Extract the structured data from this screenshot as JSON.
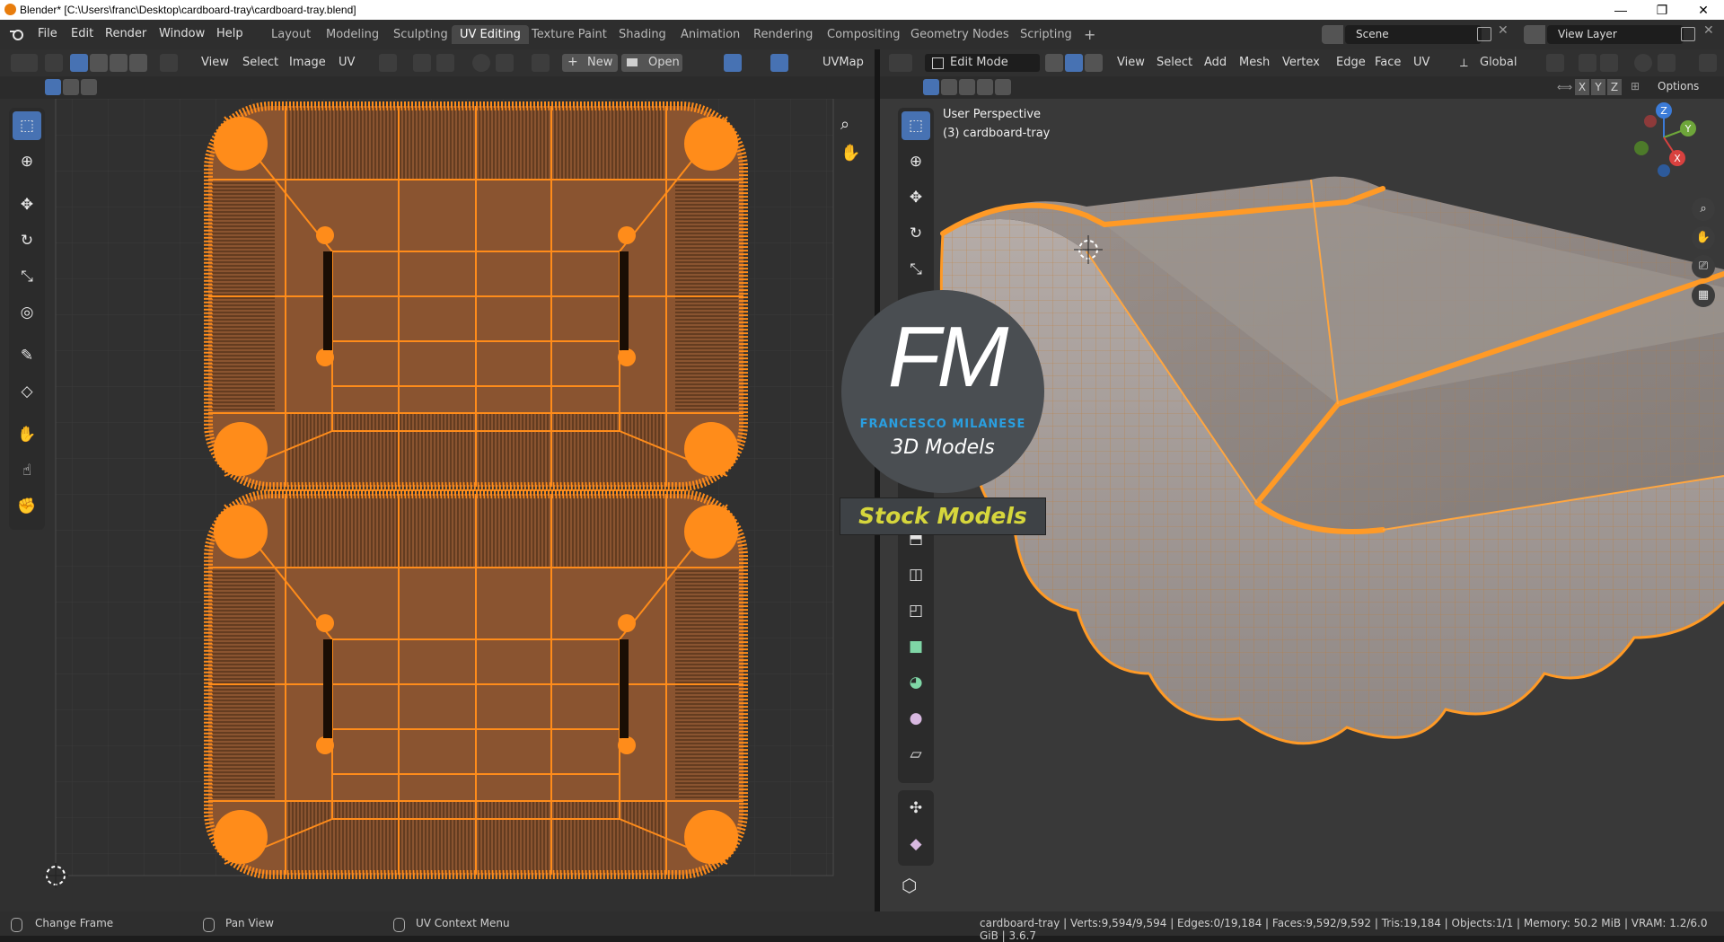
{
  "title_bar": {
    "title": "Blender* [C:\\Users\\franc\\Desktop\\cardboard-tray\\cardboard-tray.blend]",
    "minimize": "—",
    "restore": "❐",
    "close": "✕"
  },
  "menus": [
    "File",
    "Edit",
    "Render",
    "Window",
    "Help"
  ],
  "workspaces": [
    {
      "label": "Layout",
      "active": false
    },
    {
      "label": "Modeling",
      "active": false
    },
    {
      "label": "Sculpting",
      "active": false
    },
    {
      "label": "UV Editing",
      "active": true
    },
    {
      "label": "Texture Paint",
      "active": false
    },
    {
      "label": "Shading",
      "active": false
    },
    {
      "label": "Animation",
      "active": false
    },
    {
      "label": "Rendering",
      "active": false
    },
    {
      "label": "Compositing",
      "active": false
    },
    {
      "label": "Geometry Nodes",
      "active": false
    },
    {
      "label": "Scripting",
      "active": false
    }
  ],
  "add_workspace": "+",
  "scene": "Scene",
  "view_layer": "View Layer",
  "uv_editor": {
    "menus": [
      "View",
      "Select",
      "Image",
      "UV"
    ],
    "new_label": "New",
    "open_label": "Open",
    "uvmap": "UVMap"
  },
  "viewport": {
    "mode": "Edit Mode",
    "menus": [
      "View",
      "Select",
      "Add",
      "Mesh",
      "Vertex",
      "Edge",
      "Face",
      "UV"
    ],
    "orientation": "Global",
    "axes": [
      "X",
      "Y",
      "Z"
    ],
    "options": "Options",
    "overlay_view": "User Perspective",
    "overlay_object": "(3) cardboard-tray",
    "gizmo": {
      "x": "X",
      "y": "Y",
      "z": "Z"
    }
  },
  "watermark": {
    "monogram": "FM",
    "name": "FRANCESCO MILANESE",
    "sub": "3D Models",
    "banner": "Stock Models"
  },
  "status": {
    "left": "Change Frame",
    "mid": "Pan View",
    "right": "UV Context Menu",
    "stats": "cardboard-tray | Verts:9,594/9,594 | Edges:0/19,184 | Faces:9,592/9,592 | Tris:19,184 | Objects:1/1 | Memory: 50.2 MiB | VRAM: 1.2/6.0 GiB | 3.6.7"
  },
  "colors": {
    "accent": "#4772b3",
    "selection": "#ff8c1a",
    "uv_face": "#8a5430"
  }
}
